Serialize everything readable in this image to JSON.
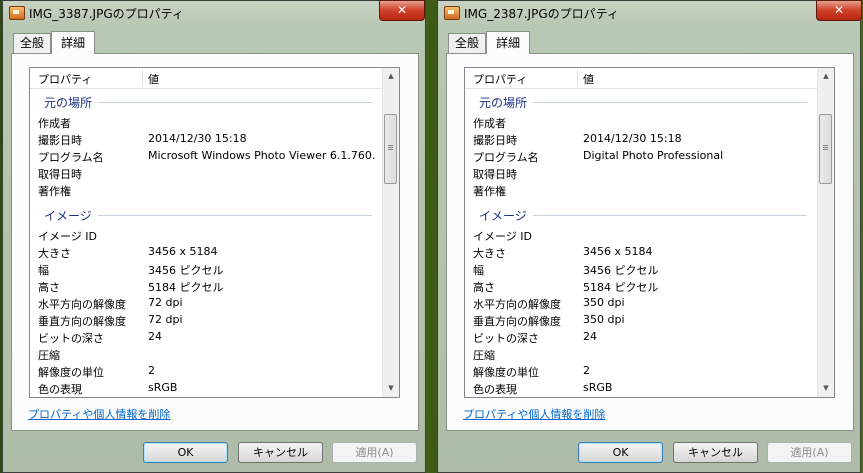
{
  "windows": [
    {
      "title": "IMG_3387.JPGのプロパティ",
      "tabs": [
        "全般",
        "詳細"
      ],
      "columns": {
        "property": "プロパティ",
        "value": "値"
      },
      "groups": {
        "origin": {
          "label": "元の場所",
          "rows": [
            {
              "name": "作成者",
              "value": ""
            },
            {
              "name": "撮影日時",
              "value": "2014/12/30 15:18"
            },
            {
              "name": "プログラム名",
              "value": "Microsoft Windows Photo Viewer 6.1.760..."
            },
            {
              "name": "取得日時",
              "value": ""
            },
            {
              "name": "著作権",
              "value": ""
            }
          ]
        },
        "image": {
          "label": "イメージ",
          "rows": [
            {
              "name": "イメージ ID",
              "value": ""
            },
            {
              "name": "大きさ",
              "value": "3456 x 5184"
            },
            {
              "name": "幅",
              "value": "3456 ピクセル"
            },
            {
              "name": "高さ",
              "value": "5184 ピクセル"
            },
            {
              "name": "水平方向の解像度",
              "value": "72 dpi"
            },
            {
              "name": "垂直方向の解像度",
              "value": "72 dpi"
            },
            {
              "name": "ビットの深さ",
              "value": "24"
            },
            {
              "name": "圧縮",
              "value": ""
            },
            {
              "name": "解像度の単位",
              "value": "2"
            },
            {
              "name": "色の表現",
              "value": "sRGB"
            }
          ]
        }
      },
      "remove_link": "プロパティや個人情報を削除",
      "buttons": {
        "ok": "OK",
        "cancel": "キャンセル",
        "apply": "適用(A)"
      }
    },
    {
      "title": "IMG_2387.JPGのプロパティ",
      "tabs": [
        "全般",
        "詳細"
      ],
      "columns": {
        "property": "プロパティ",
        "value": "値"
      },
      "groups": {
        "origin": {
          "label": "元の場所",
          "rows": [
            {
              "name": "作成者",
              "value": ""
            },
            {
              "name": "撮影日時",
              "value": "2014/12/30 15:18"
            },
            {
              "name": "プログラム名",
              "value": "Digital Photo Professional"
            },
            {
              "name": "取得日時",
              "value": ""
            },
            {
              "name": "著作権",
              "value": ""
            }
          ]
        },
        "image": {
          "label": "イメージ",
          "rows": [
            {
              "name": "イメージ ID",
              "value": ""
            },
            {
              "name": "大きさ",
              "value": "3456 x 5184"
            },
            {
              "name": "幅",
              "value": "3456 ピクセル"
            },
            {
              "name": "高さ",
              "value": "5184 ピクセル"
            },
            {
              "name": "水平方向の解像度",
              "value": "350 dpi"
            },
            {
              "name": "垂直方向の解像度",
              "value": "350 dpi"
            },
            {
              "name": "ビットの深さ",
              "value": "24"
            },
            {
              "name": "圧縮",
              "value": ""
            },
            {
              "name": "解像度の単位",
              "value": "2"
            },
            {
              "name": "色の表現",
              "value": "sRGB"
            }
          ]
        }
      },
      "remove_link": "プロパティや個人情報を削除",
      "buttons": {
        "ok": "OK",
        "cancel": "キャンセル",
        "apply": "適用(A)"
      }
    }
  ]
}
